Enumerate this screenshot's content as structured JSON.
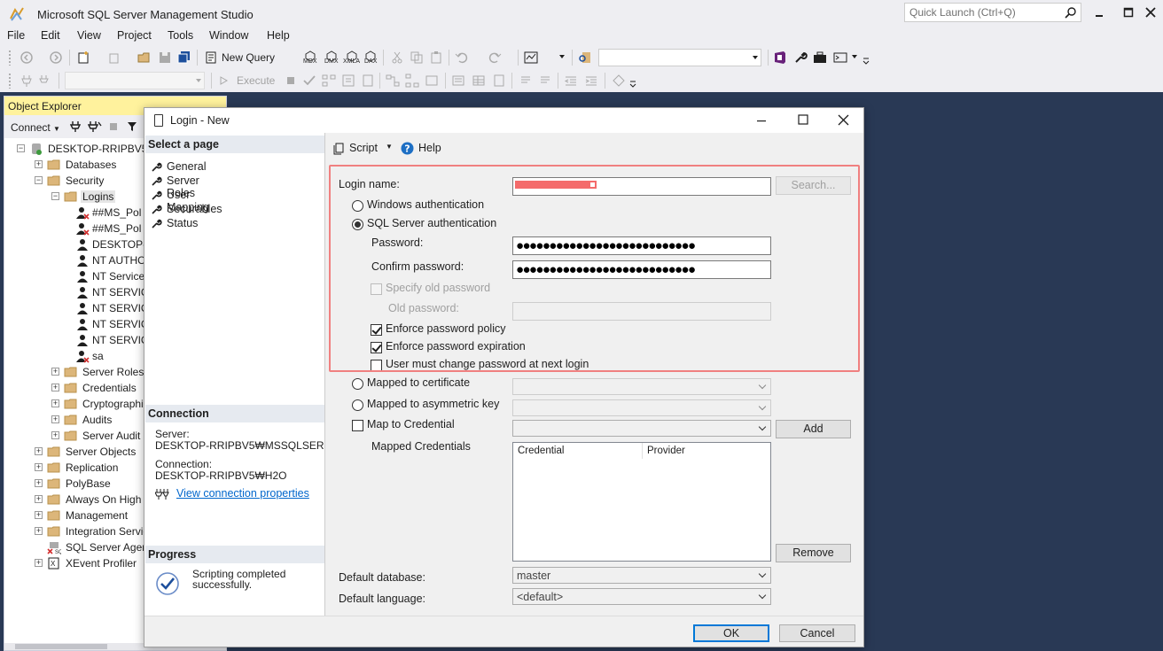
{
  "app": {
    "title": "Microsoft SQL Server Management Studio",
    "quick_launch_placeholder": "Quick Launch (Ctrl+Q)"
  },
  "menu": [
    "File",
    "Edit",
    "View",
    "Project",
    "Tools",
    "Window",
    "Help"
  ],
  "toolbar": {
    "new_query": "New Query",
    "mdx": "MDX",
    "dmx": "DMX",
    "xmla": "XMLA",
    "dax": "DAX",
    "execute": "Execute"
  },
  "object_explorer": {
    "title": "Object Explorer",
    "connect": "Connect",
    "tree": [
      {
        "label": "DESKTOP-RRIPBV5₩",
        "level": 0,
        "expander": "-",
        "icon": "server-icon"
      },
      {
        "label": "Databases",
        "level": 1,
        "expander": "+",
        "icon": "folder-icon"
      },
      {
        "label": "Security",
        "level": 1,
        "expander": "-",
        "icon": "folder-icon"
      },
      {
        "label": "Logins",
        "level": 2,
        "expander": "-",
        "icon": "folder-icon"
      },
      {
        "label": "##MS_Pol",
        "level": 3,
        "expander": "",
        "icon": "login-disabled-icon"
      },
      {
        "label": "##MS_Pol",
        "level": 3,
        "expander": "",
        "icon": "login-disabled-icon"
      },
      {
        "label": "DESKTOP-",
        "level": 3,
        "expander": "",
        "icon": "login-icon"
      },
      {
        "label": "NT AUTHO",
        "level": 3,
        "expander": "",
        "icon": "login-icon"
      },
      {
        "label": "NT Service",
        "level": 3,
        "expander": "",
        "icon": "login-icon"
      },
      {
        "label": "NT SERVIC",
        "level": 3,
        "expander": "",
        "icon": "login-icon"
      },
      {
        "label": "NT SERVIC",
        "level": 3,
        "expander": "",
        "icon": "login-icon"
      },
      {
        "label": "NT SERVIC",
        "level": 3,
        "expander": "",
        "icon": "login-icon"
      },
      {
        "label": "NT SERVIC",
        "level": 3,
        "expander": "",
        "icon": "login-icon"
      },
      {
        "label": "sa",
        "level": 3,
        "expander": "",
        "icon": "login-disabled-icon"
      },
      {
        "label": "Server Roles",
        "level": 2,
        "expander": "+",
        "icon": "folder-icon"
      },
      {
        "label": "Credentials",
        "level": 2,
        "expander": "+",
        "icon": "folder-icon"
      },
      {
        "label": "Cryptographic",
        "level": 2,
        "expander": "+",
        "icon": "folder-icon"
      },
      {
        "label": "Audits",
        "level": 2,
        "expander": "+",
        "icon": "folder-icon"
      },
      {
        "label": "Server Audit S",
        "level": 2,
        "expander": "+",
        "icon": "folder-icon"
      },
      {
        "label": "Server Objects",
        "level": 1,
        "expander": "+",
        "icon": "folder-icon"
      },
      {
        "label": "Replication",
        "level": 1,
        "expander": "+",
        "icon": "folder-icon"
      },
      {
        "label": "PolyBase",
        "level": 1,
        "expander": "+",
        "icon": "folder-icon"
      },
      {
        "label": "Always On High A",
        "level": 1,
        "expander": "+",
        "icon": "folder-icon"
      },
      {
        "label": "Management",
        "level": 1,
        "expander": "+",
        "icon": "folder-icon"
      },
      {
        "label": "Integration Servic",
        "level": 1,
        "expander": "+",
        "icon": "folder-icon"
      },
      {
        "label": "SQL Server Agent",
        "level": 1,
        "expander": "",
        "icon": "agent-icon"
      },
      {
        "label": "XEvent Profiler",
        "level": 1,
        "expander": "+",
        "icon": "xevent-icon"
      }
    ]
  },
  "dialog": {
    "title": "Login - New",
    "select_page": "Select a page",
    "pages": [
      "General",
      "Server Roles",
      "User Mapping",
      "Securables",
      "Status"
    ],
    "connection_header": "Connection",
    "server_label": "Server:",
    "server_value": "DESKTOP-RRIPBV5₩MSSQLSER",
    "connection_label": "Connection:",
    "connection_value": "DESKTOP-RRIPBV5₩H2O",
    "view_connection_properties": "View connection properties",
    "progress_header": "Progress",
    "progress_status": "Scripting completed successfully.",
    "script": "Script",
    "help": "Help",
    "login_name_label": "Login name:",
    "search_button": "Search...",
    "windows_auth": "Windows authentication",
    "sql_auth": "SQL Server authentication",
    "password_label": "Password:",
    "password_value": "●●●●●●●●●●●●●●●●●●●●●●●●●●●",
    "confirm_password_label": "Confirm password:",
    "confirm_password_value": "●●●●●●●●●●●●●●●●●●●●●●●●●●●",
    "specify_old_password": "Specify old password",
    "old_password_label": "Old password:",
    "enforce_policy": "Enforce password policy",
    "enforce_expiration": "Enforce password expiration",
    "must_change": "User must change password at next login",
    "mapped_certificate": "Mapped to certificate",
    "mapped_asym_key": "Mapped to asymmetric key",
    "map_credential": "Map to Credential",
    "add_button": "Add",
    "mapped_credentials": "Mapped Credentials",
    "grid_col_credential": "Credential",
    "grid_col_provider": "Provider",
    "remove_button": "Remove",
    "default_database_label": "Default database:",
    "default_database_value": "master",
    "default_language_label": "Default language:",
    "default_language_value": "<default>",
    "ok_button": "OK",
    "cancel_button": "Cancel"
  },
  "colors": {
    "workspace_bg": "#293955",
    "oe_header_bg": "#fff29d",
    "highlight_border": "#f08080",
    "redaction": "#f46b6b"
  }
}
